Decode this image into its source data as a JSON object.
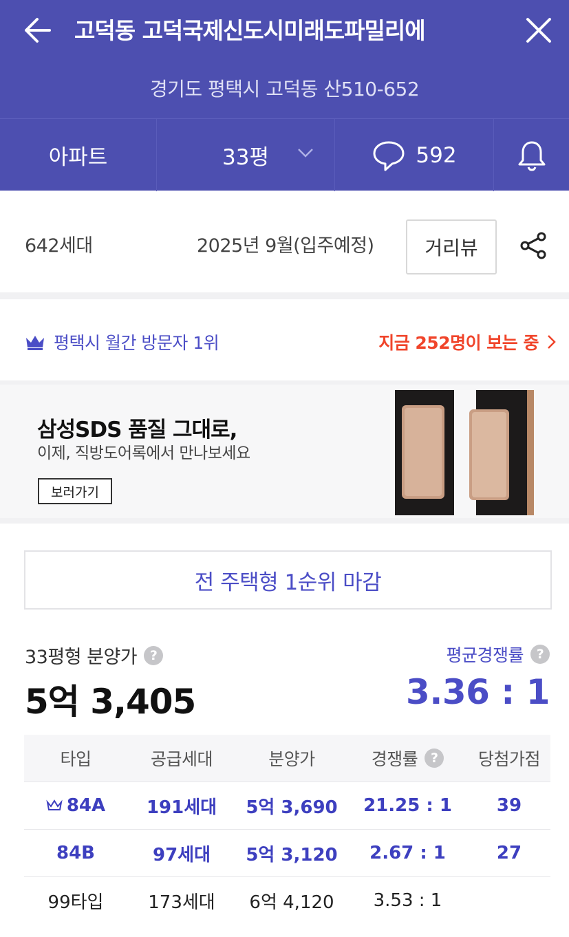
{
  "header": {
    "title": "고덕동 고덕국제신도시미래도파밀리에",
    "address": "경기도 평택시 고덕동 산510-652",
    "tabs": {
      "type": "아파트",
      "size": "33평",
      "comment_count": "592"
    }
  },
  "info": {
    "households": "642세대",
    "move_in": "2025년 9월(입주예정)",
    "distance_view": "거리뷰"
  },
  "rank": {
    "label": "평택시 월간 방문자 1위",
    "viewers": "지금 252명이 보는 중"
  },
  "ad": {
    "title": "삼성SDS 품질 그대로,",
    "subtitle": "이제, 직방도어록에서 만나보세요",
    "button": "보러가기"
  },
  "closing_banner": "전 주택형 1순위 마감",
  "price": {
    "label": "33평형 분양가",
    "value": "5억 3,405",
    "competition_label": "평균경쟁률",
    "competition_value": "3.36 : 1"
  },
  "table": {
    "headers": [
      "타입",
      "공급세대",
      "분양가",
      "경쟁률",
      "당첨가점"
    ],
    "rows": [
      {
        "type": "84A",
        "supply": "191세대",
        "price": "5억 3,690",
        "competition": "21.25 : 1",
        "score": "39",
        "highlight": true,
        "crown": true
      },
      {
        "type": "84B",
        "supply": "97세대",
        "price": "5억 3,120",
        "competition": "2.67 : 1",
        "score": "27",
        "highlight": true,
        "crown": false
      },
      {
        "type": "99타입",
        "supply": "173세대",
        "price": "6억 4,120",
        "competition": "3.53 : 1",
        "score": "",
        "highlight": false,
        "crown": false
      }
    ]
  },
  "colors": {
    "header_bg": "#4d4fb0",
    "accent": "#4b4dc6",
    "hot": "#f0442a"
  }
}
